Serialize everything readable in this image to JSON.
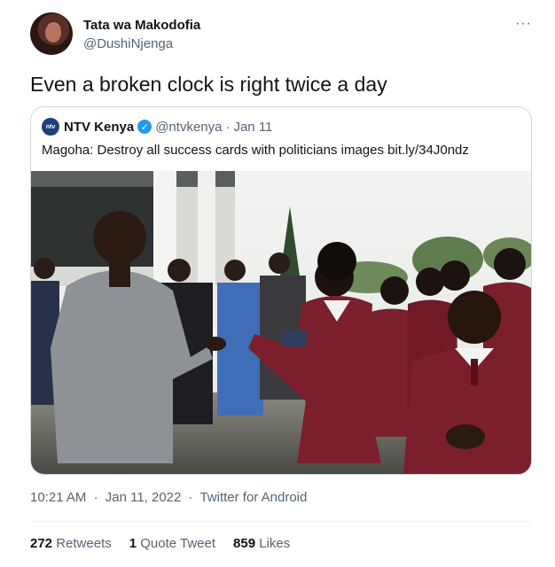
{
  "author": {
    "display_name": "Tata wa Makodofia",
    "handle": "@DushiNjenga",
    "avatar_icon": "profile-photo"
  },
  "more_icon": "···",
  "tweet_text": "Even a broken clock is right twice a day",
  "quote": {
    "logo_text": "ntv",
    "name": "NTV Kenya",
    "verified_icon": "✓",
    "handle": "@ntvkenya",
    "separator": "·",
    "date": "Jan 11",
    "text": "Magoha: Destroy all success cards with politicians images bit.ly/34J0ndz"
  },
  "meta": {
    "time": "10:21 AM",
    "separator": "·",
    "date": "Jan 11, 2022",
    "source": "Twitter for Android"
  },
  "stats": [
    {
      "count": "272",
      "label": "Retweets"
    },
    {
      "count": "1",
      "label": "Quote Tweet"
    },
    {
      "count": "859",
      "label": "Likes"
    }
  ],
  "colors": {
    "text_primary": "#0f1419",
    "text_secondary": "#536471",
    "border": "#cfd9de",
    "verified": "#1d9bf0",
    "uniform_maroon": "#7a1f2b"
  }
}
